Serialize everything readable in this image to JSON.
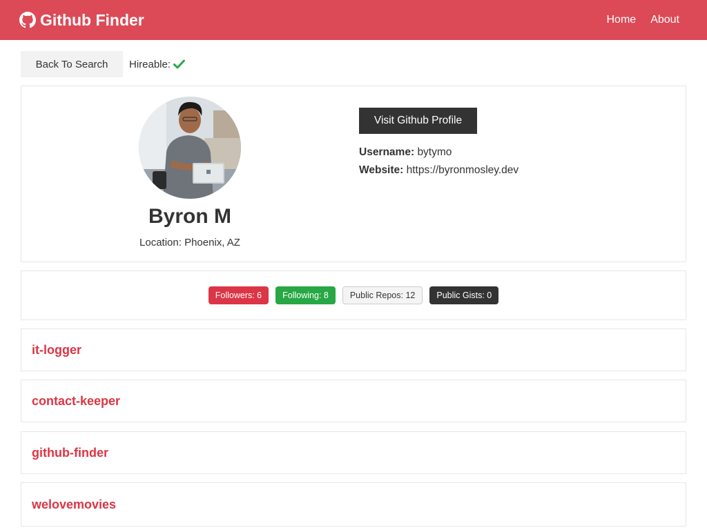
{
  "navbar": {
    "title": "Github Finder",
    "brand_icon": "github-icon",
    "links": [
      "Home",
      "About"
    ],
    "color": "#dc4a57"
  },
  "toolbar": {
    "back_label": "Back To Search",
    "hireable_label": "Hireable:",
    "hireable": true,
    "check_color": "#28a745"
  },
  "profile": {
    "name": "Byron M",
    "location": "Location: Phoenix, AZ",
    "visit_label": "Visit Github Profile",
    "username_label": "Username:",
    "username": "bytymo",
    "website_label": "Website:",
    "website": "https://byronmosley.dev"
  },
  "stats": {
    "followers": "Followers: 6",
    "following": "Following: 8",
    "public_repos": "Public Repos: 12",
    "public_gists": "Public Gists: 0"
  },
  "repos": [
    "it-logger",
    "contact-keeper",
    "github-finder",
    "welovemovies"
  ]
}
